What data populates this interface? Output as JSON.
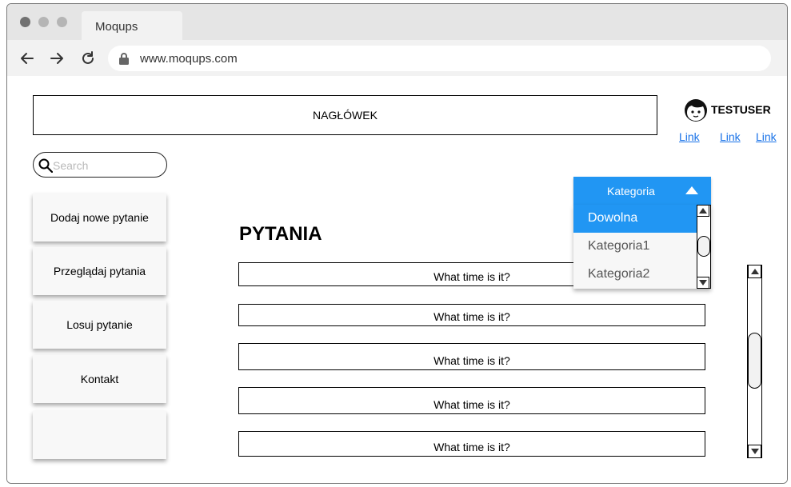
{
  "browser": {
    "tab_title": "Moqups",
    "url": "www.moqups.com"
  },
  "header": {
    "title": "NAGŁÓWEK"
  },
  "user": {
    "name": "TESTUSER",
    "links": [
      "Link",
      "Link",
      "Link"
    ]
  },
  "search": {
    "placeholder": "Search",
    "value": ""
  },
  "sidebar": {
    "items": [
      {
        "label": "Dodaj nowe pytanie"
      },
      {
        "label": "Przeglądaj pytania"
      },
      {
        "label": "Losuj pytanie"
      },
      {
        "label": "Kontakt"
      },
      {
        "label": ""
      }
    ]
  },
  "main": {
    "title": "PYTANIA",
    "questions": [
      "What time is it?",
      "What time is it?",
      "What time is it?",
      "What time is it?",
      "What time is it?"
    ]
  },
  "category_dropdown": {
    "label": "Kategoria",
    "options": [
      "Dowolna",
      "Kategoria1",
      "Kategoria2"
    ],
    "selected": "Dowolna"
  },
  "colors": {
    "accent": "#2196f3",
    "link": "#1a73e8"
  }
}
